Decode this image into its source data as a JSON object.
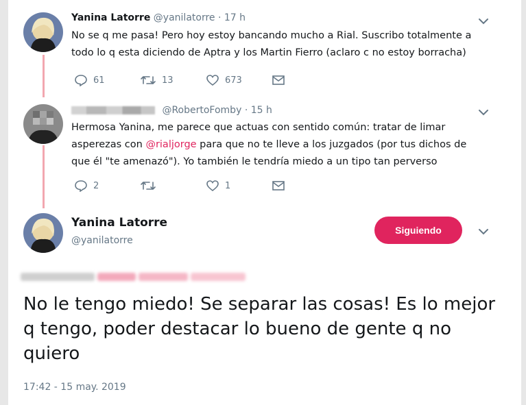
{
  "colors": {
    "accent": "#e0245e",
    "muted": "#657786",
    "thread_line": "#f2a7b0",
    "text": "#14171a"
  },
  "tweet1": {
    "name": "Yanina Latorre",
    "handle": "@yanilatorre",
    "separator": "·",
    "time": "17 h",
    "text_line1": "No se q me pasa! Pero hoy estoy bancando mucho a Rial. Suscribo totalmente a",
    "text_line2": "todo lo q esta diciendo de Aptra y los Martin Fierro (aclaro c no estoy borracha)",
    "actions": {
      "reply_icon": "reply-icon",
      "reply_count": "61",
      "retweet_icon": "retweet-icon",
      "retweet_count": "13",
      "like_icon": "heart-icon",
      "like_count": "673",
      "message_icon": "envelope-icon"
    }
  },
  "tweet2": {
    "handle": "@RobertoFomby",
    "separator": "·",
    "time": "15 h",
    "text_line1": "Hermosa Yanina, me parece que actuas con sentido común: tratar de limar",
    "text_line2_prefix": "asperezas con ",
    "mention": "@rialjorge",
    "text_line2_suffix": " para que no te lleve a los juzgados (por tus dichos de",
    "text_line3": "que él \"te amenazó\"). Yo también le tendría miedo a un tipo tan perverso",
    "actions": {
      "reply_icon": "reply-icon",
      "reply_count": "2",
      "retweet_icon": "retweet-icon",
      "retweet_count": "",
      "like_icon": "heart-icon",
      "like_count": "1",
      "message_icon": "envelope-icon"
    }
  },
  "main_tweet": {
    "name": "Yanina Latorre",
    "handle": "@yanilatorre",
    "follow_label": "Siguiendo",
    "text": "No le tengo miedo! Se separar las cosas! Es lo mejor q tengo, poder destacar lo bueno de gente q no quiero",
    "timestamp": "17:42 - 15 may. 2019"
  }
}
